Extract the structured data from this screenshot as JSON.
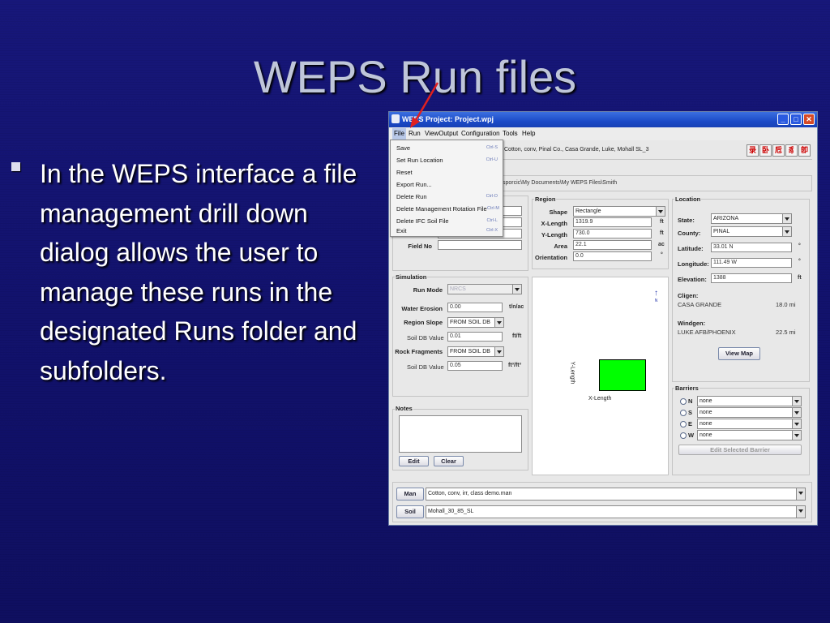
{
  "slide": {
    "title": "WEPS Run files",
    "bullet": "In the WEPS interface a file management drill down dialog allows the user to manage these runs in the designated Runs folder and subfolders."
  },
  "window": {
    "title": "WEPS Project: Project.wpj",
    "icon": "weps-app-icon",
    "menubar": [
      "File",
      "Run",
      "ViewOutput",
      "Configuration",
      "Tools",
      "Help"
    ],
    "toolbar_text": "Cotton, conv, Pinal Co., Casa Grande, Luke, Mohall SL_3",
    "toolbar_icons": [
      "run-icon-1",
      "run-icon-2",
      "run-icon-3",
      "run-icon-4",
      "run-icon-5"
    ],
    "path": "sporcic\\My Documents\\My WEPS Files\\Smith",
    "file_menu": [
      {
        "label": "Save",
        "shortcut": "Ctrl-S"
      },
      {
        "label": "Set Run Location",
        "shortcut": "Ctrl-U"
      },
      {
        "label": "Reset",
        "shortcut": ""
      },
      {
        "label": "Export Run...",
        "shortcut": ""
      },
      {
        "label": "Delete Run",
        "shortcut": "Ctrl-D"
      },
      {
        "label": "Delete Management Rotation File",
        "shortcut": "Ctrl-M"
      },
      {
        "label": "Delete IFC Soil File",
        "shortcut": "Ctrl-L"
      },
      {
        "label": "Exit",
        "shortcut": "Ctrl-X"
      }
    ],
    "field_no_label": "Field No",
    "region": {
      "title": "Region",
      "shape_label": "Shape",
      "shape": "Rectangle",
      "xlength_label": "X-Length",
      "xlength": "1319.9",
      "xlength_unit": "ft",
      "ylength_label": "Y-Length",
      "ylength": "730.0",
      "ylength_unit": "ft",
      "area_label": "Area",
      "area": "22.1",
      "area_unit": "ac",
      "orientation_label": "Orientation",
      "orientation": "0.0",
      "orientation_unit": "°"
    },
    "location": {
      "title": "Location",
      "state_label": "State:",
      "state": "ARIZONA",
      "county_label": "County:",
      "county": "PINAL",
      "latitude_label": "Latitude:",
      "latitude": "33.01 N",
      "lat_unit": "°",
      "longitude_label": "Longitude:",
      "longitude": "111.49 W",
      "lon_unit": "°",
      "elevation_label": "Elevation:",
      "elevation": "1388",
      "elev_unit": "ft",
      "cligen_label": "Cligen:",
      "cligen_station": "CASA GRANDE",
      "cligen_dist": "18.0  mi",
      "windgen_label": "Windgen:",
      "windgen_station": "LUKE AFB/PHOENIX",
      "windgen_dist": "22.5  mi",
      "view_map": "View Map"
    },
    "simulation": {
      "title": "Simulation",
      "runmode_label": "Run Mode",
      "runmode": "NRCS",
      "water_label": "Water Erosion",
      "water": "0.00",
      "water_unit": "t/n/ac",
      "slope_label": "Region Slope",
      "slope": "FROM SOIL DB",
      "slope_db_label": "Soil DB Value",
      "slope_db": "0.01",
      "slope_unit": "ft/ft",
      "rock_label": "Rock Fragments",
      "rock": "FROM SOIL DB",
      "rock_db_label": "Soil DB Value",
      "rock_db": "0.05",
      "rock_unit": "ft³/ft³"
    },
    "field": {
      "xlabel": "X-Length",
      "ylabel": "Y-Length",
      "north": "N",
      "field_color": "#00ff00"
    },
    "notes": {
      "title": "Notes",
      "edit": "Edit",
      "clear": "Clear"
    },
    "barriers": {
      "title": "Barriers",
      "rows": [
        {
          "dir": "N",
          "value": "none"
        },
        {
          "dir": "S",
          "value": "none"
        },
        {
          "dir": "E",
          "value": "none"
        },
        {
          "dir": "W",
          "value": "none"
        }
      ],
      "edit": "Edit Selected Barrier"
    },
    "man": {
      "button": "Man",
      "value": "Cotton, conv, irr, class demo.man"
    },
    "soil": {
      "button": "Soil",
      "value": "Mohall_30_85_SL"
    }
  }
}
